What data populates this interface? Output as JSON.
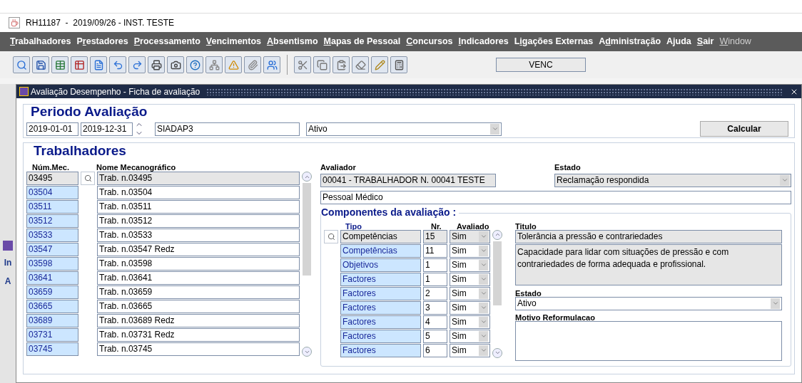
{
  "window": {
    "title": "RH11187  -  2019/09/26 - INST. TESTE"
  },
  "menu": [
    {
      "key": "T",
      "post": "rabalhadores",
      "disabled": false
    },
    {
      "pre": "P",
      "key": "r",
      "post": "estadores",
      "disabled": false
    },
    {
      "key": "P",
      "post": "rocessamento",
      "disabled": false
    },
    {
      "key": "V",
      "post": "encimentos",
      "disabled": false
    },
    {
      "key": "A",
      "post": "bsentismo",
      "disabled": false
    },
    {
      "key": "M",
      "post": "apas de Pessoal",
      "disabled": false
    },
    {
      "key": "C",
      "post": "oncursos",
      "disabled": false
    },
    {
      "key": "I",
      "post": "ndicadores",
      "disabled": false
    },
    {
      "pre": "L",
      "key": "i",
      "post": "gações Externas",
      "disabled": false
    },
    {
      "pre": "A",
      "key": "d",
      "post": "ministração",
      "disabled": false
    },
    {
      "pre": "A",
      "key": "j",
      "post": "uda",
      "disabled": false
    },
    {
      "key": "S",
      "post": "air",
      "disabled": false
    },
    {
      "key": "W",
      "post": "indow",
      "disabled": true
    }
  ],
  "status_field": "VENC",
  "background_window": {
    "labels": [
      "In",
      "A"
    ]
  },
  "inner_window": {
    "title": "Avaliação Desempenho - Ficha de avaliação"
  },
  "periodo": {
    "heading": "Periodo Avaliação",
    "start": "2019-01-01",
    "end": "2019-12-31",
    "model": "SIADAP3",
    "state": "Ativo",
    "calculate": "Calcular"
  },
  "trabalhadores": {
    "heading": "Trabalhadores",
    "columns": [
      "Núm.Mec.",
      "Nome Mecanográfico"
    ],
    "rows": [
      {
        "num": "03495",
        "name": "Trab. n.03495",
        "selected": true
      },
      {
        "num": "03504",
        "name": "Trab. n.03504",
        "selected": false
      },
      {
        "num": "03511",
        "name": "Trab. n.03511",
        "selected": false
      },
      {
        "num": "03512",
        "name": "Trab. n.03512",
        "selected": false
      },
      {
        "num": "03533",
        "name": "Trab. n.03533",
        "selected": false
      },
      {
        "num": "03547",
        "name": "Trab. n.03547 Redz",
        "selected": false
      },
      {
        "num": "03598",
        "name": "Trab. n.03598",
        "selected": false
      },
      {
        "num": "03641",
        "name": "Trab. n.03641",
        "selected": false
      },
      {
        "num": "03659",
        "name": "Trab. n.03659",
        "selected": false
      },
      {
        "num": "03665",
        "name": "Trab. n.03665",
        "selected": false
      },
      {
        "num": "03689",
        "name": "Trab. n.03689 Redz",
        "selected": false
      },
      {
        "num": "03731",
        "name": "Trab. n.03731 Redz",
        "selected": false
      },
      {
        "num": "03745",
        "name": "Trab. n.03745",
        "selected": false
      }
    ]
  },
  "avaliador": {
    "label": "Avaliador",
    "value": "00041 - TRABALHADOR N. 00041 TESTE"
  },
  "estado": {
    "label": "Estado",
    "value": "Reclamação respondida"
  },
  "grupo": "Pessoal Médico",
  "componentes": {
    "heading": "Componentes da avaliação :",
    "columns": [
      "Tipo",
      "Nr.",
      "Avaliado"
    ],
    "rows": [
      {
        "tipo": "Competências",
        "nr": "15",
        "avaliado": "Sim",
        "selected": true
      },
      {
        "tipo": "Competências",
        "nr": "11",
        "avaliado": "Sim",
        "selected": false
      },
      {
        "tipo": "Objetivos",
        "nr": "1",
        "avaliado": "Sim",
        "selected": false
      },
      {
        "tipo": "Factores",
        "nr": "1",
        "avaliado": "Sim",
        "selected": false
      },
      {
        "tipo": "Factores",
        "nr": "2",
        "avaliado": "Sim",
        "selected": false
      },
      {
        "tipo": "Factores",
        "nr": "3",
        "avaliado": "Sim",
        "selected": false
      },
      {
        "tipo": "Factores",
        "nr": "4",
        "avaliado": "Sim",
        "selected": false
      },
      {
        "tipo": "Factores",
        "nr": "5",
        "avaliado": "Sim",
        "selected": false
      },
      {
        "tipo": "Factores",
        "nr": "6",
        "avaliado": "Sim",
        "selected": false
      }
    ],
    "titulo": {
      "label": "Titulo",
      "value": "Tolerância a pressão e contrariedades"
    },
    "descricao": "Capacidade para lidar com situações de pressão e com contrariedades de forma adequada e profissional.",
    "estado": {
      "label": "Estado",
      "value": "Ativo"
    },
    "motivo": {
      "label": "Motivo Reformulacao"
    }
  }
}
